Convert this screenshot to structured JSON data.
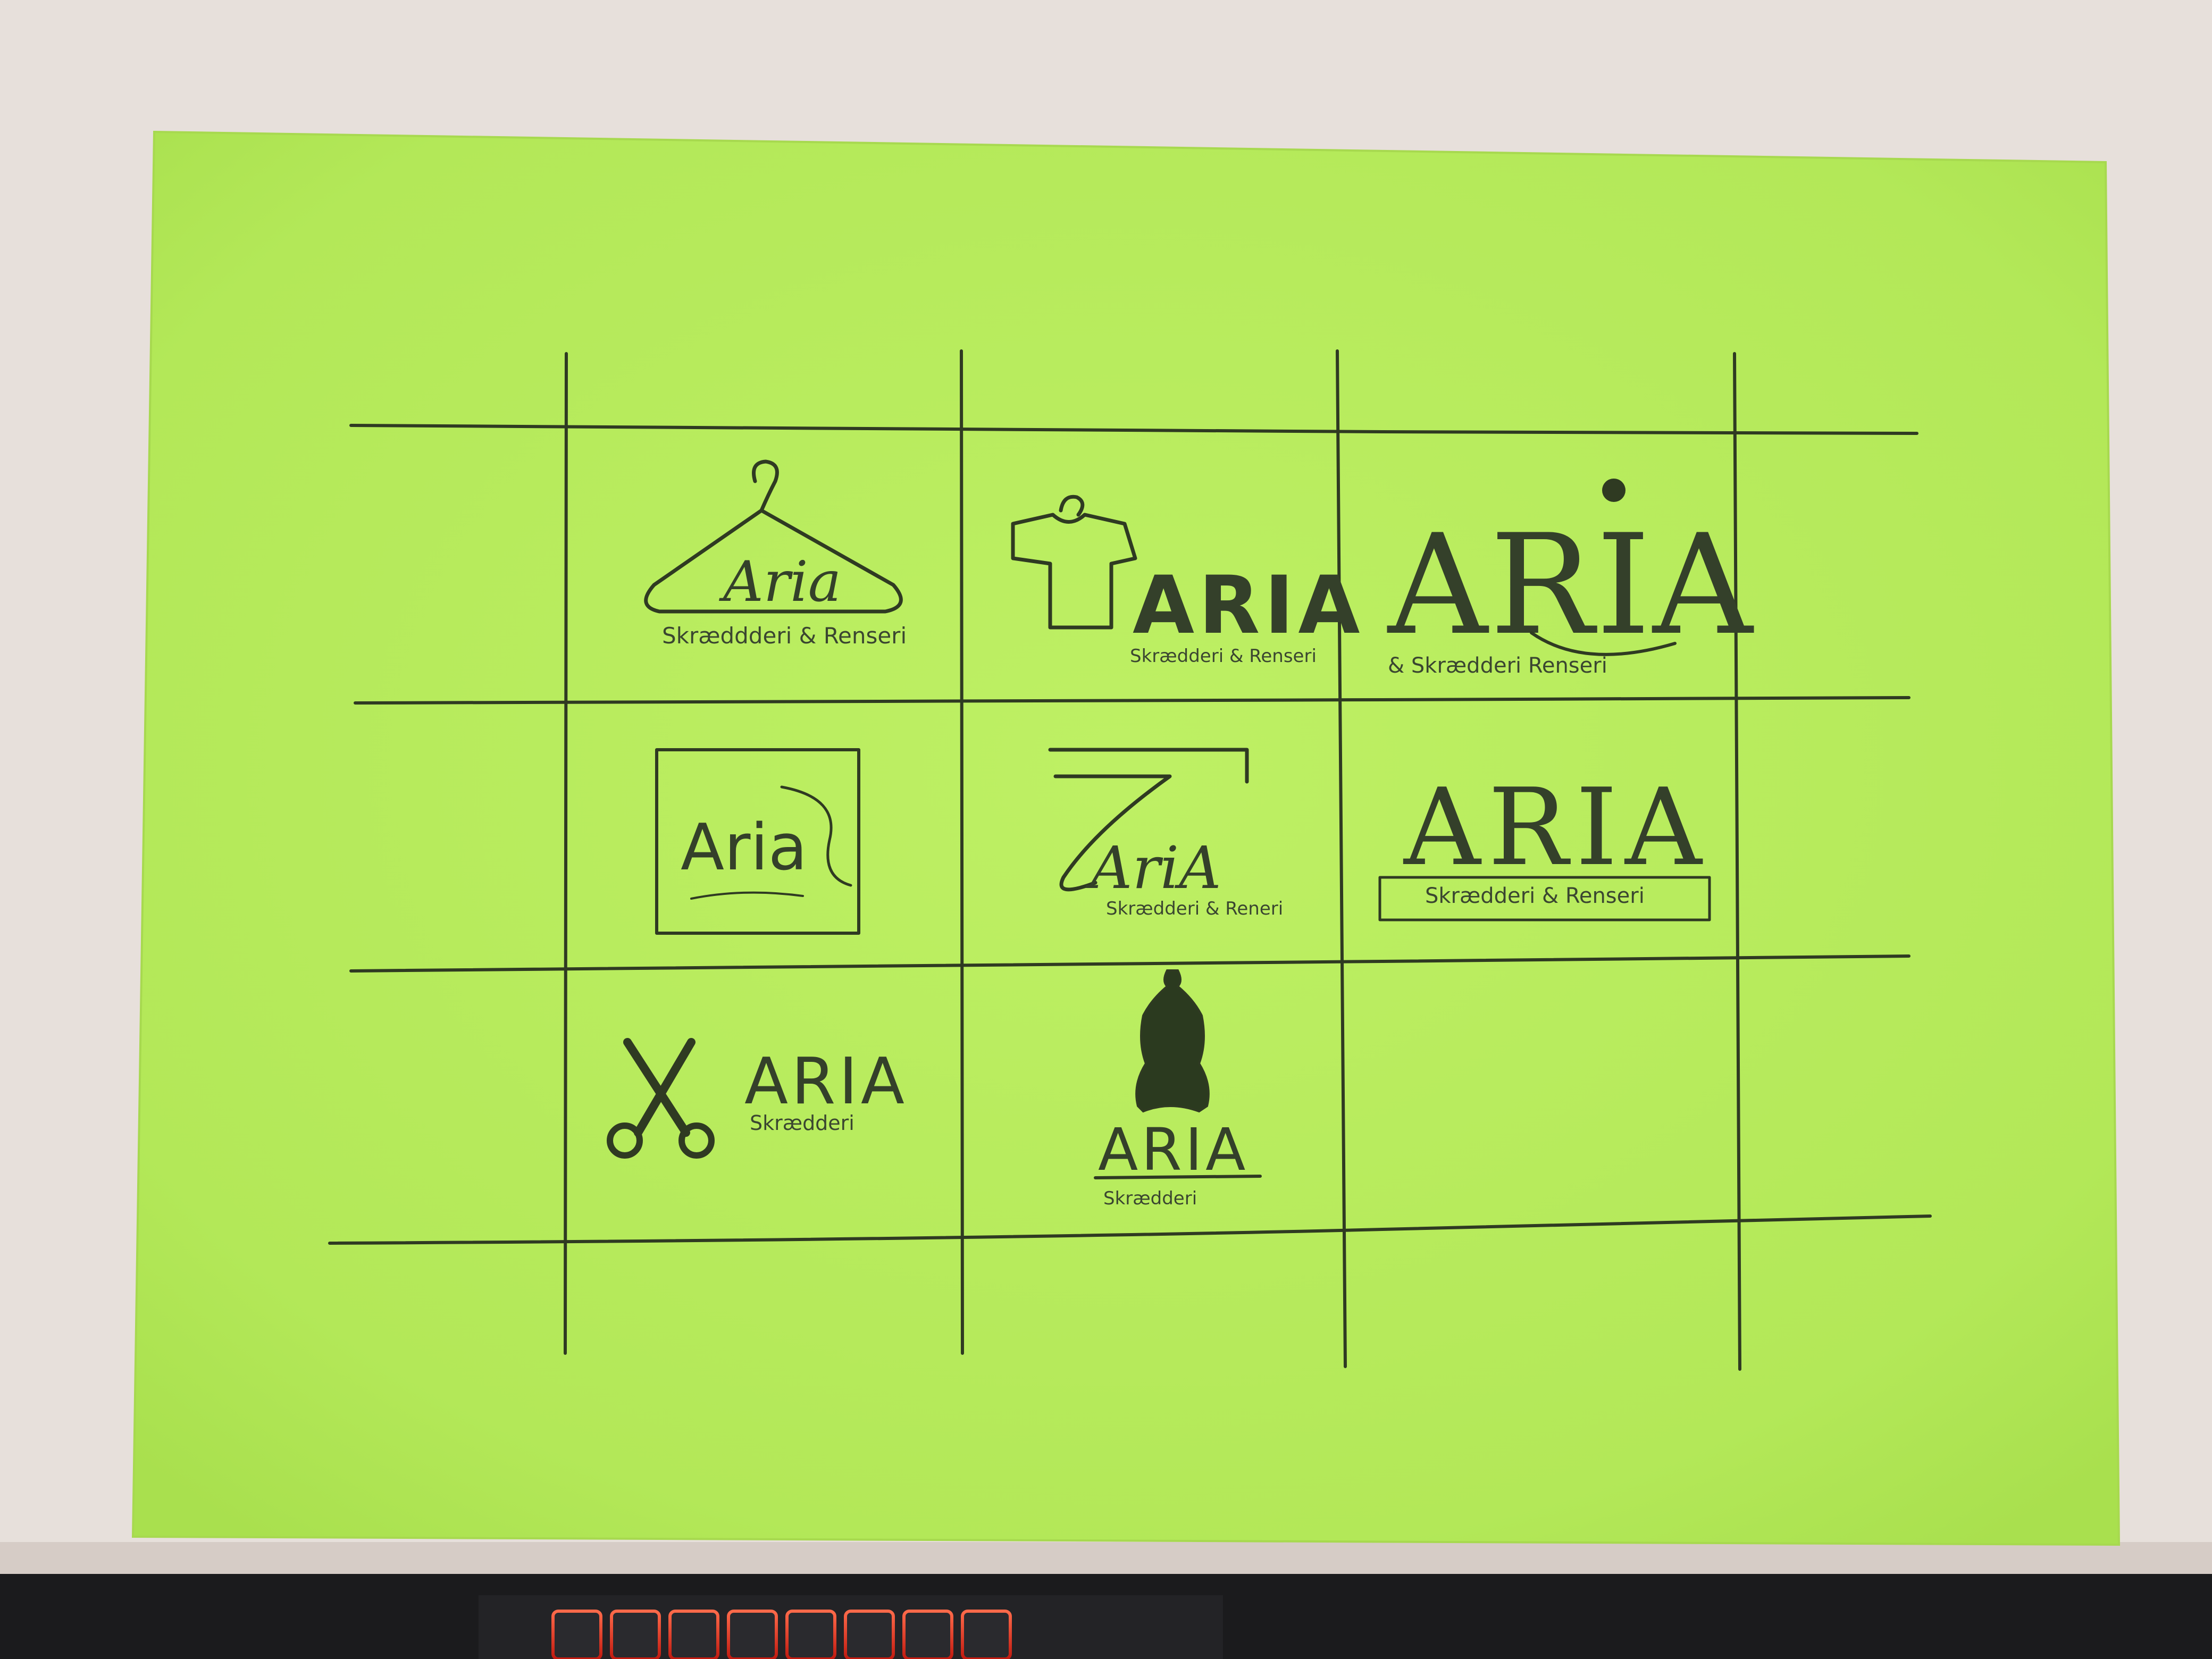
{
  "photo": {
    "colors": {
      "desk": "#e7e0db",
      "paper": "#b8ec5c",
      "pencil": "#2f3a22",
      "keyboard": "#1b1b1d",
      "key_glow": "#ff3a2a"
    }
  },
  "sketches": [
    {
      "id": "hanger",
      "icon": "hanger-icon",
      "wordmark": "Aria",
      "tagline": "Skræddderi & Renseri"
    },
    {
      "id": "tshirt",
      "icon": "tshirt-icon",
      "wordmark": "ARIA",
      "tagline": "Skrædderi & Renseri"
    },
    {
      "id": "needle",
      "icon": "needle-icon",
      "wordmark": "ARIA",
      "tagline": "& Skrædderi Renseri"
    },
    {
      "id": "framed",
      "icon": "thread-icon",
      "wordmark": "Aria",
      "tagline": ""
    },
    {
      "id": "seven",
      "icon": "tape-icon",
      "wordmark": "AriA",
      "tagline": "Skrædderi & Reneri"
    },
    {
      "id": "banner",
      "icon": "",
      "wordmark": "ARIA",
      "tagline": "Skrædderi & Renseri"
    },
    {
      "id": "scissors",
      "icon": "scissors-icon",
      "wordmark": "ARIA",
      "tagline": "Skrædderi"
    },
    {
      "id": "mannequin",
      "icon": "mannequin-icon",
      "wordmark": "ARIA",
      "tagline": "Skrædderi"
    }
  ]
}
